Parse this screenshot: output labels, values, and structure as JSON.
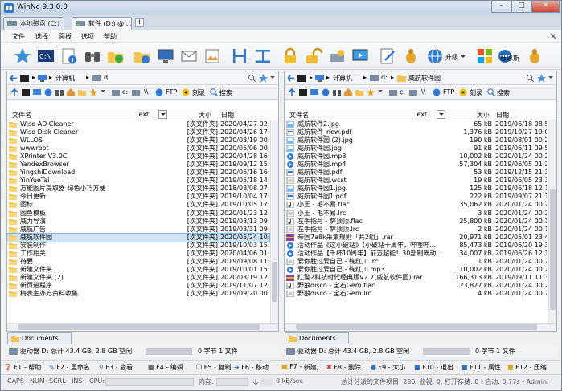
{
  "window": {
    "title": "WinNc 9.3.0.0"
  },
  "tabs": [
    {
      "label": "本地磁盘 (C:)"
    },
    {
      "label": "软件 (D:) @ ..."
    }
  ],
  "menu": [
    "文件",
    "选择",
    "面板",
    "选项",
    "帮助"
  ],
  "toolbar": {
    "upgrade_label": "升级",
    "dusters_label": "杜恩斯"
  },
  "left": {
    "path": "d:",
    "path_root": "计算机",
    "drive": "c:",
    "ftp_label": "FTP",
    "burn_label": "刻录",
    "search_label": "搜索",
    "columns": {
      "name": "文件名",
      "ext": ".ext",
      "size": "大小",
      "date": "日期"
    },
    "files": [
      {
        "name": "Wise AD Cleaner",
        "ext": "",
        "size": "[次文件夹]",
        "date": "2020/04/27 02:59"
      },
      {
        "name": "Wise Disk Cleaner",
        "ext": "",
        "size": "[次文件夹]",
        "date": "2020/04/26 17:08"
      },
      {
        "name": "WLLOS",
        "ext": "",
        "size": "[次文件夹]",
        "date": "2020/03/19 00:06"
      },
      {
        "name": "wwwroot",
        "ext": "",
        "size": "[次文件夹]",
        "date": "2020/05/06 00:53"
      },
      {
        "name": "XPrinter V3.0C",
        "ext": "",
        "size": "[次文件夹]",
        "date": "2020/04/28 16:55"
      },
      {
        "name": "YandexBrowser",
        "ext": "",
        "size": "[次文件夹]",
        "date": "2019/09/12 15:55"
      },
      {
        "name": "YingshiDownload",
        "ext": "",
        "size": "[次文件夹]",
        "date": "2020/05/16 16:28"
      },
      {
        "name": "YinYueTai",
        "ext": "",
        "size": "[次文件夹]",
        "date": "2019/05/18 14:08"
      },
      {
        "name": "万能图片提取器 绿色小巧方便",
        "ext": "",
        "size": "[次文件夹]",
        "date": "2018/08/08 07:31"
      },
      {
        "name": "今日更新",
        "ext": "",
        "size": "[次文件夹]",
        "date": "2019/10/04 17:17"
      },
      {
        "name": "图标",
        "ext": "",
        "size": "[次文件夹]",
        "date": "2019/10/05 17:43"
      },
      {
        "name": "图鱼模板",
        "ext": "",
        "size": "[次文件夹]",
        "date": "2020/01/23 12:10"
      },
      {
        "name": "威力导演",
        "ext": "",
        "size": "[次文件夹]",
        "date": "2019/03/13 09:36"
      },
      {
        "name": "威航广告",
        "ext": "",
        "size": "[次文件夹]",
        "date": "2019/03/31 09:55"
      },
      {
        "name": "威航软件园",
        "ext": "",
        "size": "[次文件夹]",
        "date": "2020/05/24 10:31",
        "selected": true
      },
      {
        "name": "安装制作",
        "ext": "",
        "size": "[次文件夹]",
        "date": "2019/10/03 15:12"
      },
      {
        "name": "工作相关",
        "ext": "",
        "size": "[次文件夹]",
        "date": "2020/04/06 01:34"
      },
      {
        "name": "待要",
        "ext": "",
        "size": "[次文件夹]",
        "date": "2019/09/08 11:13"
      },
      {
        "name": "新建文件夹",
        "ext": "",
        "size": "[次文件夹]",
        "date": "2019/10/01 15:29"
      },
      {
        "name": "新建文件夹 (2)",
        "ext": "",
        "size": "[次文件夹]",
        "date": "2020/03/19 12:09"
      },
      {
        "name": "新页进程序",
        "ext": "",
        "size": "[次文件夹]",
        "date": "2019/11/07 12:16"
      },
      {
        "name": "梅表主办方资料收集",
        "ext": "",
        "size": "[次文件夹]",
        "date": "2019/09/20 00:59"
      }
    ],
    "doc_tab": "Documents",
    "drive_info": "驱动器 D: 总计 43.4 GB, 2.8 GB 空闲",
    "select_info": "0 字节 1 文件"
  },
  "right": {
    "path": "d:",
    "path_root": "计算机",
    "path_folder": "威航软件园",
    "drive": "c:",
    "ftp_label": "FTP",
    "burn_label": "刻录",
    "search_label": "搜索",
    "columns": {
      "name": "文件名",
      "ext": ".ext",
      "size": "大小",
      "date": "日期"
    },
    "files": [
      {
        "name": "威航软件2.jpg",
        "ext": "",
        "size": "65 kB",
        "date": "2019/06/18 08:58",
        "kind": "img"
      },
      {
        "name": "威航软件_new.pdf",
        "ext": "",
        "size": "1,376 kB",
        "date": "2019/10/27 19:05",
        "kind": "pdf"
      },
      {
        "name": "威航软件园 (2).jpg",
        "ext": "",
        "size": "190 kB",
        "date": "2019/08/01 00:22",
        "kind": "img"
      },
      {
        "name": "威航软件园.jpg",
        "ext": "",
        "size": "91 kB",
        "date": "2019/06/11 09:57",
        "kind": "img"
      },
      {
        "name": "威航软件园.mp3",
        "ext": "",
        "size": "10,002 kB",
        "date": "2020/01/24 00:27",
        "kind": "media"
      },
      {
        "name": "威航软件园.mp4",
        "ext": "",
        "size": "57,304 kB",
        "date": "2019/06/05 01:28",
        "kind": "media"
      },
      {
        "name": "威航软件园.pdf",
        "ext": "",
        "size": "53 kB",
        "date": "2019/12/15 21:36",
        "kind": "pdf"
      },
      {
        "name": "威航软件园.wcst",
        "ext": "",
        "size": "19 kB",
        "date": "2019/06/05 23:33",
        "kind": "doc"
      },
      {
        "name": "威航软件园1.jpg",
        "ext": "",
        "size": "125 kB",
        "date": "2019/06/18 12:17",
        "kind": "img"
      },
      {
        "name": "威航软件园1.pdf",
        "ext": "",
        "size": "222 kB",
        "date": "2019/09/07 21:14",
        "kind": "pdf"
      },
      {
        "name": "小王 - 毛不易.flac",
        "ext": "",
        "size": "35,062 kB",
        "date": "2020/01/24 00:27",
        "kind": "audio"
      },
      {
        "name": "小王 - 毛不易.lrc",
        "ext": "",
        "size": "3 kB",
        "date": "2020/01/24 00:27",
        "kind": "doc"
      },
      {
        "name": "左手指月 - 萨顶顶.flac",
        "ext": "",
        "size": "25,800 kB",
        "date": "2020/01/24 00:17",
        "kind": "audio"
      },
      {
        "name": "左手指月 - 萨顶顶.lrc",
        "ext": "",
        "size": "2 kB",
        "date": "2020/01/24 00:17",
        "kind": "doc"
      },
      {
        "name": "帝国7a8k采集规则「共2组」.rar",
        "ext": "",
        "size": "20,971 kB",
        "date": "2020/05/01 23:40",
        "kind": "rar"
      },
      {
        "name": "活动作品《这小破站》（小破站十周年，哔哩哔...",
        "ext": "",
        "size": "85,473 kB",
        "date": "2019/06/20 19:37",
        "kind": "media"
      },
      {
        "name": "活动作品【千杯10周年】前方超能！30部制霸动...",
        "ext": "",
        "size": "34,007 kB",
        "date": "2019/06/26 12:13",
        "kind": "media"
      },
      {
        "name": "爱你胜过爱自己 - 鞠红川.lrc",
        "ext": "",
        "size": "1 kB",
        "date": "2020/01/24 00:27",
        "kind": "doc"
      },
      {
        "name": "爱你胜过爱自己 - 鞠红川.mp3",
        "ext": "",
        "size": "10,002 kB",
        "date": "2020/01/24 00:27",
        "kind": "media"
      },
      {
        "name": "红警2科技时代经典版V2.7(威航软件园).rar",
        "ext": "",
        "size": "166,313 kB",
        "date": "2019/09/11 11:31",
        "kind": "rar"
      },
      {
        "name": "野狼disco - 宝石Gem.flac",
        "ext": "",
        "size": "23,827 kB",
        "date": "2020/01/24 00:27",
        "kind": "audio"
      },
      {
        "name": "野狼disco - 宝石Gem.lrc",
        "ext": "",
        "size": "4 kB",
        "date": "2020/01/24 00:27",
        "kind": "doc"
      }
    ],
    "doc_tab": "Documents",
    "drive_info": "驱动器 D: 总计 43.4 GB, 2.8 GB 空闲",
    "select_info": "0 字节 1 文件"
  },
  "fkeys": [
    {
      "key": "F1",
      "label": "帮助"
    },
    {
      "key": "F2",
      "label": "重命名"
    },
    {
      "key": "F3",
      "label": "查看"
    },
    {
      "key": "F4",
      "label": "编辑"
    },
    {
      "key": "F5",
      "label": "复制"
    },
    {
      "key": "F6",
      "label": "移动"
    },
    {
      "key": "F7",
      "label": "新建文件夹"
    },
    {
      "key": "F8",
      "label": "删除"
    },
    {
      "key": "F9",
      "label": "大小"
    },
    {
      "key": "F10",
      "label": "退出"
    },
    {
      "key": "F11",
      "label": "属性"
    },
    {
      "key": "F12",
      "label": "压缩"
    }
  ],
  "status": {
    "caps": "CAPS",
    "num": "NUM",
    "scrl": "SCRL",
    "ins": "INS",
    "cpu_label": "CPU:",
    "mem_label": "内存:",
    "net": "0 kB/sec",
    "summary": "总计分派的文件项目: 296, 监视: 0, 打开存储: 0 - 启动: 0.77s - Admini"
  }
}
